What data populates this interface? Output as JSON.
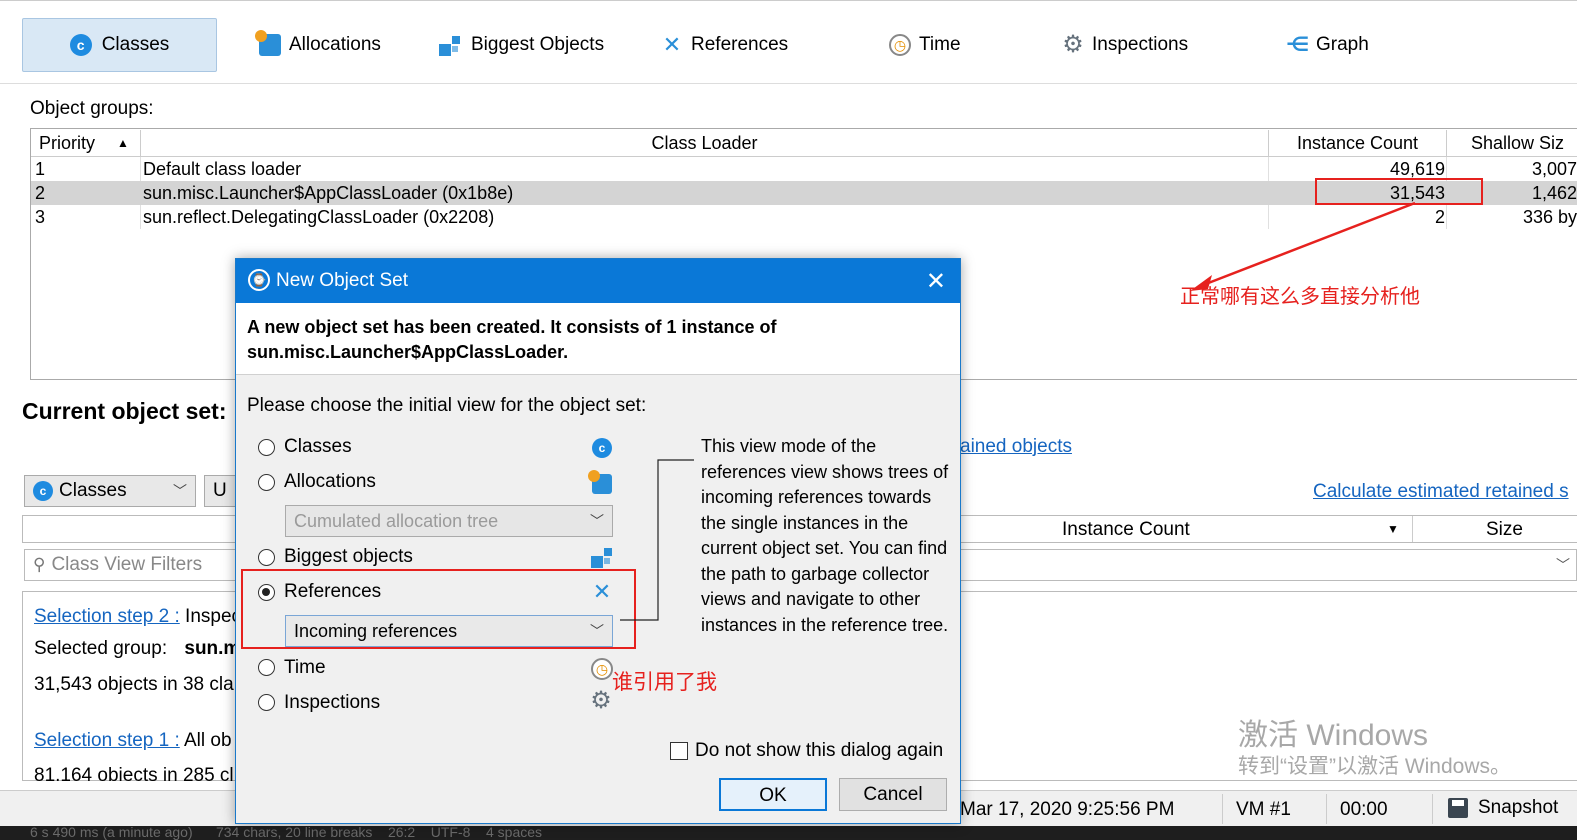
{
  "top_tabs": [
    {
      "label": "Classes",
      "icon": "classes-icon"
    },
    {
      "label": "Allocations",
      "icon": "allocations-icon"
    },
    {
      "label": "Biggest Objects",
      "icon": "biggest-objects-icon"
    },
    {
      "label": "References",
      "icon": "references-icon"
    },
    {
      "label": "Time",
      "icon": "time-icon"
    },
    {
      "label": "Inspections",
      "icon": "inspections-icon"
    },
    {
      "label": "Graph",
      "icon": "graph-icon"
    }
  ],
  "object_groups": {
    "title": "Object groups:",
    "headers": [
      "Priority",
      "Class Loader",
      "Instance Count",
      "Shallow Siz"
    ],
    "rows": [
      {
        "priority": "1",
        "loader": "Default class loader",
        "count": "49,619",
        "size": "3,007"
      },
      {
        "priority": "2",
        "loader": "sun.misc.Launcher$AppClassLoader (0x1b8e)",
        "count": "31,543",
        "size": "1,462"
      },
      {
        "priority": "3",
        "loader": "sun.reflect.DelegatingClassLoader (0x2208)",
        "count": "2",
        "size": "336 by"
      }
    ]
  },
  "annotation_1": "正常哪有这么多直接分析他",
  "annotation_2": "谁引用了我",
  "current_set": {
    "title": "Current object set:",
    "view_select": "Classes",
    "second_button": "U",
    "retained_link": "ained objects",
    "calc_link": "Calculate estimated retained s",
    "col_instance_count": "Instance Count",
    "col_size": "Size",
    "filter_placeholder": "Class View Filters",
    "step2_link": "Selection step 2 :",
    "step2_text": "Inspec",
    "selected_group_label": "Selected group:",
    "selected_group_value": "sun.m",
    "objects_line": "31,543 objects in 38 cla",
    "step1_link": "Selection step 1 :",
    "step1_text": "All ob",
    "objects_line2": "81,164 objects in 285 cl"
  },
  "dialog": {
    "title": "New Object Set",
    "message": "A new object set has been created. It consists of 1 instance of sun.misc.Launcher$AppClassLoader.",
    "prompt": "Please choose the initial view for the object set:",
    "options": [
      "Classes",
      "Allocations",
      "Biggest objects",
      "References",
      "Time",
      "Inspections"
    ],
    "allocation_select": "Cumulated allocation tree",
    "references_select": "Incoming references",
    "description": "This view mode of the references view shows trees of incoming references towards the single instances in the current object set. You can find the path to garbage collector views and navigate to other instances in the reference tree.",
    "checkbox_label": "Do not show this dialog again",
    "ok": "OK",
    "cancel": "Cancel"
  },
  "status_bar": {
    "date": "Mar 17, 2020 9:25:56 PM",
    "vm": "VM #1",
    "time": "00:00",
    "snapshot": "Snapshot"
  },
  "watermark": {
    "line1": "激活 Windows",
    "line2": "转到“设置”以激活 Windows。"
  },
  "bottom_strip": "6 s 490 ms (a minute ago)      734 chars, 20 line breaks    26:2    UTF-8    4 spaces"
}
